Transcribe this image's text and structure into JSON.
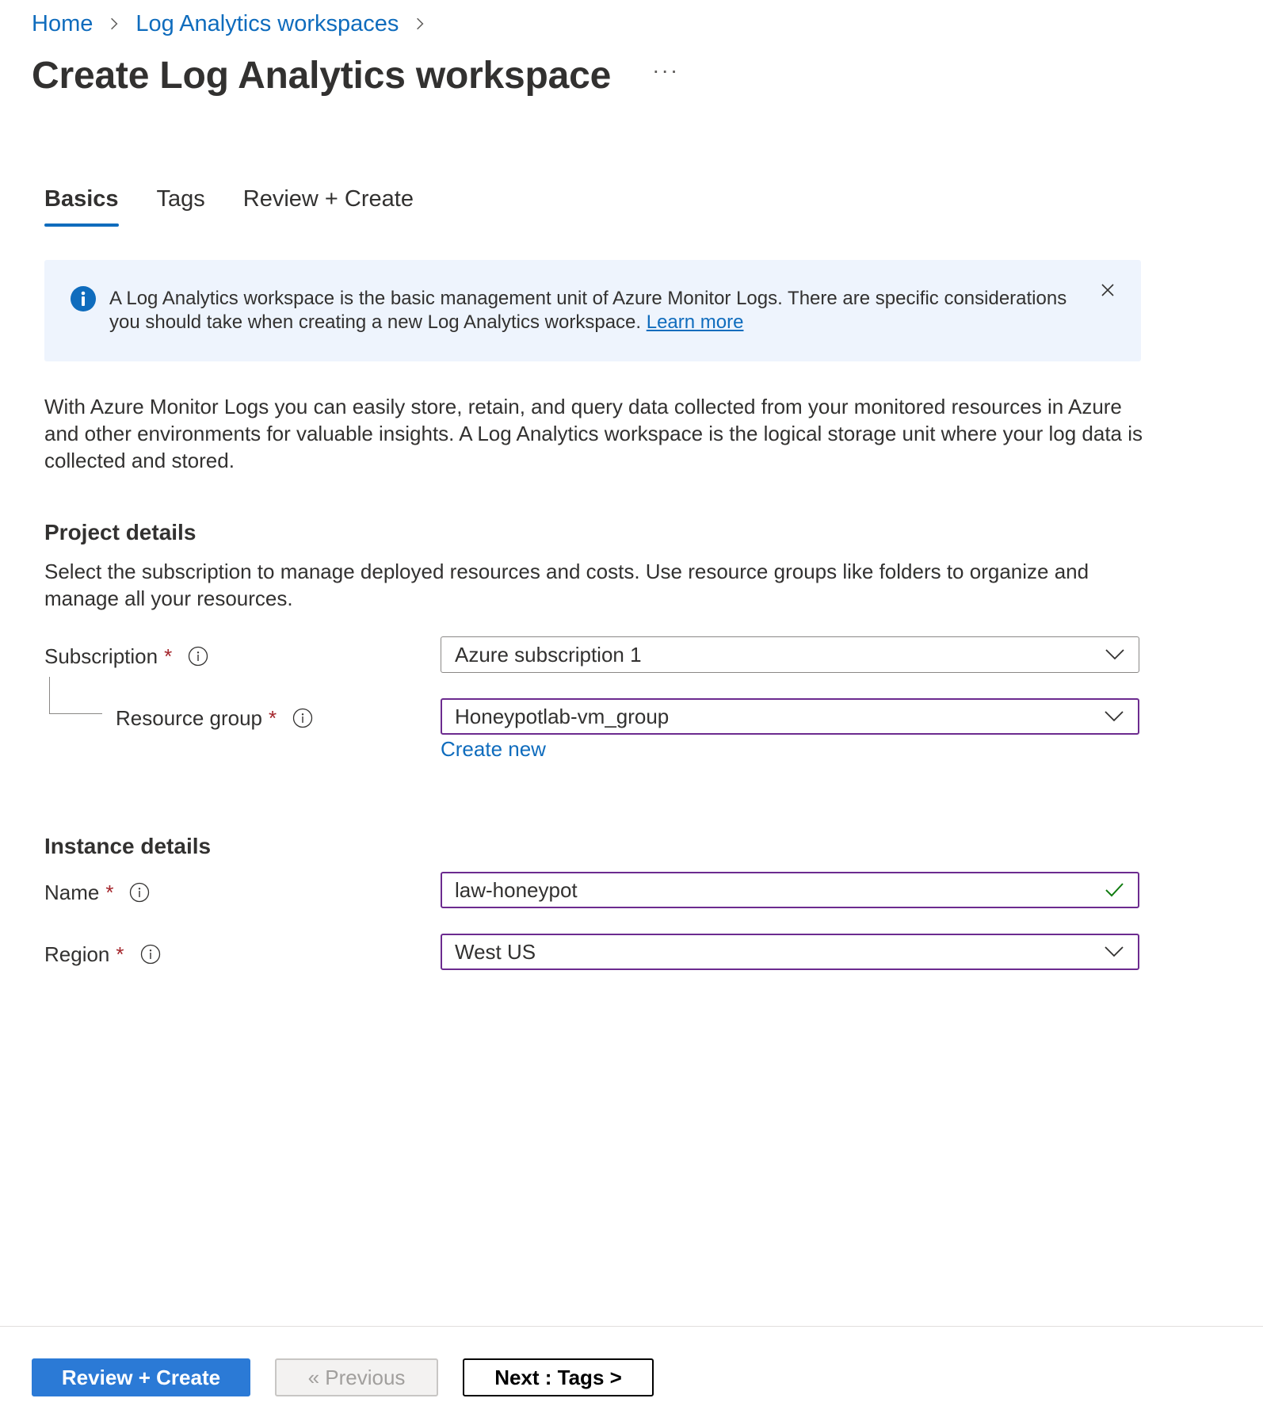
{
  "breadcrumb": {
    "home": "Home",
    "workspaces": "Log Analytics workspaces"
  },
  "page": {
    "title": "Create Log Analytics workspace",
    "more": "···"
  },
  "tabs": [
    {
      "label": "Basics",
      "active": true
    },
    {
      "label": "Tags"
    },
    {
      "label": "Review + Create"
    }
  ],
  "banner": {
    "text": "A Log Analytics workspace is the basic management unit of Azure Monitor Logs. There are specific considerations you should take when creating a new Log Analytics workspace. ",
    "link": "Learn more"
  },
  "intro": "With Azure Monitor Logs you can easily store, retain, and query data collected from your monitored resources in Azure and other environments for valuable insights. A Log Analytics workspace is the logical storage unit where your log data is collected and stored.",
  "project": {
    "title": "Project details",
    "desc": "Select the subscription to manage deployed resources and costs. Use resource groups like folders to organize and manage all your resources.",
    "subscription_label": "Subscription",
    "subscription_value": "Azure subscription 1",
    "rg_label": "Resource group",
    "rg_value": "Honeypotlab-vm_group",
    "create_new": "Create new"
  },
  "instance": {
    "title": "Instance details",
    "name_label": "Name",
    "name_value": "law-honeypot",
    "region_label": "Region",
    "region_value": "West US"
  },
  "required_mark": "*",
  "footer": {
    "review_create": "Review + Create",
    "previous": "« Previous",
    "next": "Next : Tags >"
  },
  "colors": {
    "link": "#0f6cbd",
    "primary": "#2b7ad6",
    "focus_border": "#6c2b8f",
    "required": "#a4262c",
    "banner_bg": "#eef4fd",
    "valid": "#107c10"
  }
}
